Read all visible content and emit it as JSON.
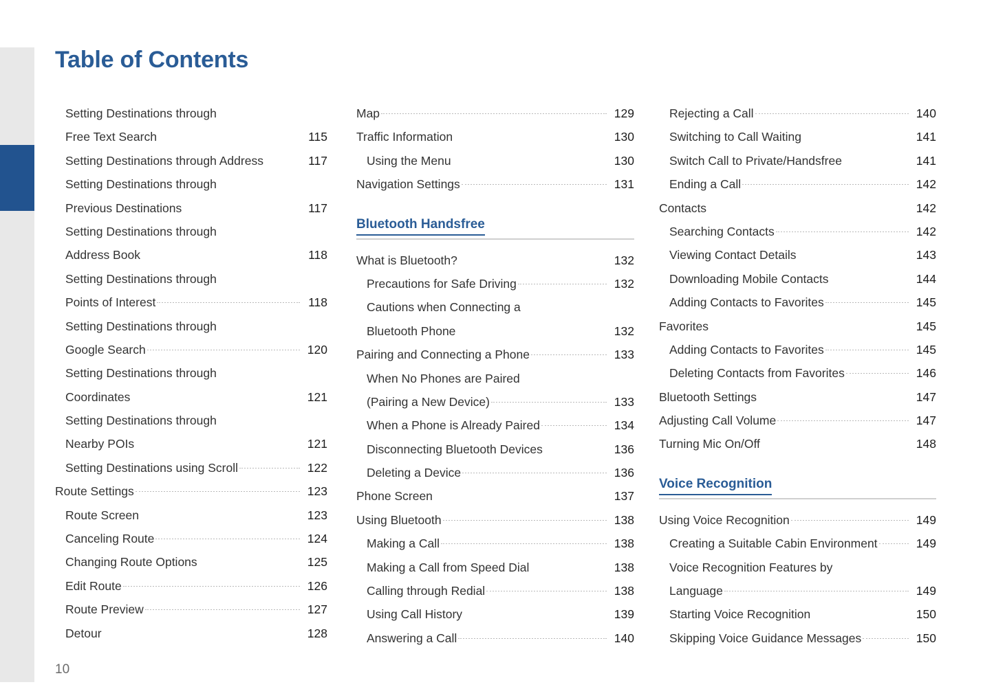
{
  "page": {
    "title": "Table of Contents",
    "folio": "10",
    "accent_color": "#2a5c96",
    "tab_color": "#22538f",
    "strip_color": "#e8e8e8"
  },
  "columns": [
    {
      "name": "column-left",
      "blocks": [
        {
          "type": "entries",
          "entries": [
            {
              "label": "Setting Destinations through",
              "page": "",
              "level": 2
            },
            {
              "label": "Free Text Search",
              "page": "115",
              "level": 2
            },
            {
              "label": "Setting Destinations through Address",
              "page": "117",
              "level": 2
            },
            {
              "label": "Setting Destinations through",
              "page": "",
              "level": 2
            },
            {
              "label": "Previous Destinations",
              "page": "117",
              "level": 2
            },
            {
              "label": "Setting Destinations through",
              "page": "",
              "level": 2
            },
            {
              "label": "Address Book",
              "page": "118",
              "level": 2
            },
            {
              "label": "Setting Destinations through",
              "page": "",
              "level": 2
            },
            {
              "label": "Points of Interest",
              "page": "118",
              "level": 2
            },
            {
              "label": "Setting Destinations through",
              "page": "",
              "level": 2
            },
            {
              "label": "Google Search",
              "page": "120",
              "level": 2
            },
            {
              "label": "Setting Destinations through",
              "page": "",
              "level": 2
            },
            {
              "label": "Coordinates",
              "page": "121",
              "level": 2
            },
            {
              "label": "Setting Destinations through",
              "page": "",
              "level": 2
            },
            {
              "label": "Nearby POIs",
              "page": "121",
              "level": 2
            },
            {
              "label": "Setting Destinations using Scroll",
              "page": "122",
              "level": 2
            },
            {
              "label": "Route Settings",
              "page": "123",
              "level": 1
            },
            {
              "label": "Route Screen",
              "page": "123",
              "level": 2
            },
            {
              "label": "Canceling Route",
              "page": "124",
              "level": 2
            },
            {
              "label": "Changing Route Options",
              "page": "125",
              "level": 2
            },
            {
              "label": "Edit Route",
              "page": "126",
              "level": 2
            },
            {
              "label": "Route Preview",
              "page": "127",
              "level": 2
            },
            {
              "label": "Detour",
              "page": "128",
              "level": 2
            }
          ]
        }
      ]
    },
    {
      "name": "column-middle",
      "blocks": [
        {
          "type": "entries",
          "entries": [
            {
              "label": "Map",
              "page": "129",
              "level": 1
            },
            {
              "label": "Traffic Information",
              "page": "130",
              "level": 1
            },
            {
              "label": "Using the Menu",
              "page": "130",
              "level": 2
            },
            {
              "label": "Navigation Settings",
              "page": "131",
              "level": 1
            }
          ]
        },
        {
          "type": "section",
          "heading": "Bluetooth Handsfree",
          "entries": [
            {
              "label": "What is Bluetooth?",
              "page": "132",
              "level": 1
            },
            {
              "label": "Precautions for Safe Driving",
              "page": "132",
              "level": 2
            },
            {
              "label": "Cautions when Connecting a",
              "page": "",
              "level": 2
            },
            {
              "label": "Bluetooth Phone",
              "page": "132",
              "level": 2
            },
            {
              "label": "Pairing and Connecting a Phone",
              "page": "133",
              "level": 1
            },
            {
              "label": "When No Phones are Paired",
              "page": "",
              "level": 2
            },
            {
              "label": "(Pairing a New Device)",
              "page": "133",
              "level": 2
            },
            {
              "label": "When a Phone is Already Paired",
              "page": "134",
              "level": 2
            },
            {
              "label": "Disconnecting Bluetooth Devices",
              "page": "136",
              "level": 2
            },
            {
              "label": "Deleting a Device",
              "page": "136",
              "level": 2
            },
            {
              "label": "Phone Screen",
              "page": "137",
              "level": 1
            },
            {
              "label": "Using Bluetooth",
              "page": "138",
              "level": 1
            },
            {
              "label": "Making a Call",
              "page": "138",
              "level": 2
            },
            {
              "label": "Making a Call from Speed Dial",
              "page": "138",
              "level": 2
            },
            {
              "label": "Calling through Redial",
              "page": "138",
              "level": 2
            },
            {
              "label": "Using Call History",
              "page": "139",
              "level": 2
            },
            {
              "label": "Answering a Call",
              "page": "140",
              "level": 2
            }
          ]
        }
      ]
    },
    {
      "name": "column-right",
      "blocks": [
        {
          "type": "entries",
          "entries": [
            {
              "label": "Rejecting a Call",
              "page": "140",
              "level": 2
            },
            {
              "label": "Switching to Call Waiting",
              "page": "141",
              "level": 2
            },
            {
              "label": "Switch Call to Private/Handsfree",
              "page": "141",
              "level": 2
            },
            {
              "label": "Ending a Call",
              "page": "142",
              "level": 2
            },
            {
              "label": "Contacts",
              "page": "142",
              "level": 1
            },
            {
              "label": "Searching Contacts",
              "page": "142",
              "level": 2
            },
            {
              "label": "Viewing Contact Details",
              "page": "143",
              "level": 2
            },
            {
              "label": "Downloading Mobile Contacts",
              "page": "144",
              "level": 2
            },
            {
              "label": "Adding Contacts to Favorites",
              "page": "145",
              "level": 2
            },
            {
              "label": "Favorites",
              "page": "145",
              "level": 1
            },
            {
              "label": "Adding Contacts to Favorites",
              "page": "145",
              "level": 2
            },
            {
              "label": "Deleting Contacts from Favorites",
              "page": "146",
              "level": 2
            },
            {
              "label": "Bluetooth Settings",
              "page": "147",
              "level": 1
            },
            {
              "label": "Adjusting Call Volume",
              "page": "147",
              "level": 1
            },
            {
              "label": "Turning Mic On/Off",
              "page": "148",
              "level": 1
            }
          ]
        },
        {
          "type": "section",
          "heading": "Voice Recognition",
          "entries": [
            {
              "label": "Using Voice Recognition",
              "page": "149",
              "level": 1
            },
            {
              "label": "Creating a Suitable Cabin Environment",
              "page": "149",
              "level": 2
            },
            {
              "label": "Voice Recognition Features by",
              "page": "",
              "level": 2
            },
            {
              "label": "Language",
              "page": "149",
              "level": 2
            },
            {
              "label": "Starting Voice Recognition",
              "page": "150",
              "level": 2
            },
            {
              "label": "Skipping Voice Guidance Messages",
              "page": "150",
              "level": 2
            }
          ]
        }
      ]
    }
  ]
}
